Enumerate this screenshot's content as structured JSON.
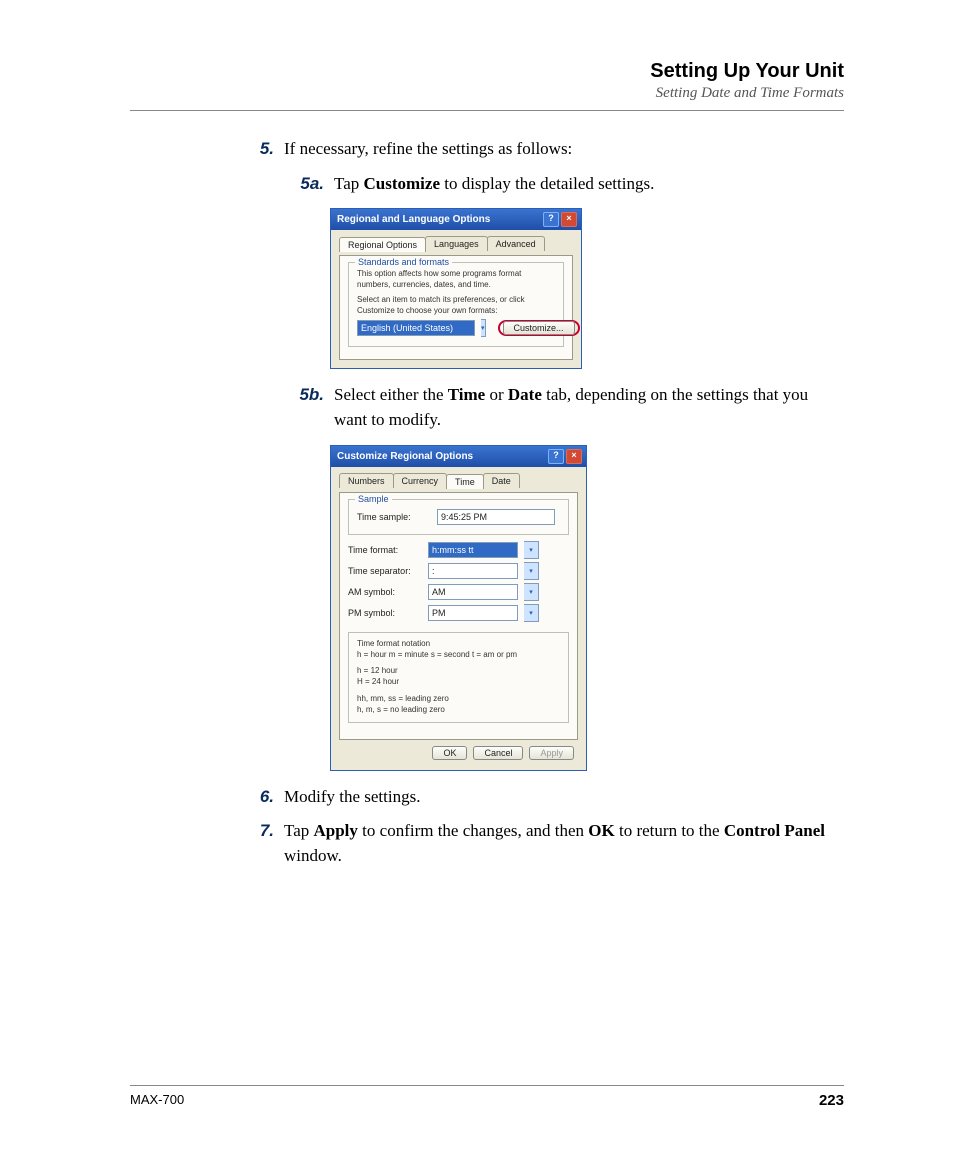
{
  "header": {
    "title": "Setting Up Your Unit",
    "subtitle": "Setting Date and Time Formats"
  },
  "steps": {
    "s5": {
      "num": "5.",
      "text_a": "If necessary, refine the settings as follows:"
    },
    "s5a": {
      "num": "5a.",
      "text_a": "Tap ",
      "bold1": "Customize",
      "text_b": " to display the detailed settings."
    },
    "s5b": {
      "num": "5b.",
      "text_a": "Select either the ",
      "bold1": "Time",
      "text_b": " or ",
      "bold2": "Date",
      "text_c": " tab, depending on the settings that you want to modify."
    },
    "s6": {
      "num": "6.",
      "text_a": "Modify the settings."
    },
    "s7": {
      "num": "7.",
      "text_a": "Tap ",
      "bold1": "Apply",
      "text_b": " to confirm the changes, and then ",
      "bold2": "OK",
      "text_c": " to return to the ",
      "bold3": "Control Panel",
      "text_d": " window."
    }
  },
  "dialog1": {
    "title": "Regional and Language Options",
    "tabs": [
      "Regional Options",
      "Languages",
      "Advanced"
    ],
    "group_label": "Standards and formats",
    "line1": "This option affects how some programs format numbers, currencies, dates, and time.",
    "line2": "Select an item to match its preferences, or click Customize to choose your own formats:",
    "dropdown_value": "English (United States)",
    "customize_btn": "Customize..."
  },
  "dialog2": {
    "title": "Customize Regional Options",
    "tabs": [
      "Numbers",
      "Currency",
      "Time",
      "Date"
    ],
    "sample_label": "Sample",
    "time_sample_label": "Time sample:",
    "time_sample_value": "9:45:25 PM",
    "rows": {
      "format": {
        "label": "Time format:",
        "value": "h:mm:ss tt"
      },
      "sep": {
        "label": "Time separator:",
        "value": ":"
      },
      "am": {
        "label": "AM symbol:",
        "value": "AM"
      },
      "pm": {
        "label": "PM symbol:",
        "value": "PM"
      }
    },
    "notation": {
      "l1": "Time format notation",
      "l2": "h = hour    m = minute    s = second    t = am or pm",
      "l3": "h = 12 hour",
      "l4": "H = 24 hour",
      "l5": "hh, mm, ss = leading zero",
      "l6": "h, m, s = no leading zero"
    },
    "buttons": {
      "ok": "OK",
      "cancel": "Cancel",
      "apply": "Apply"
    }
  },
  "footer": {
    "model": "MAX-700",
    "page": "223"
  }
}
